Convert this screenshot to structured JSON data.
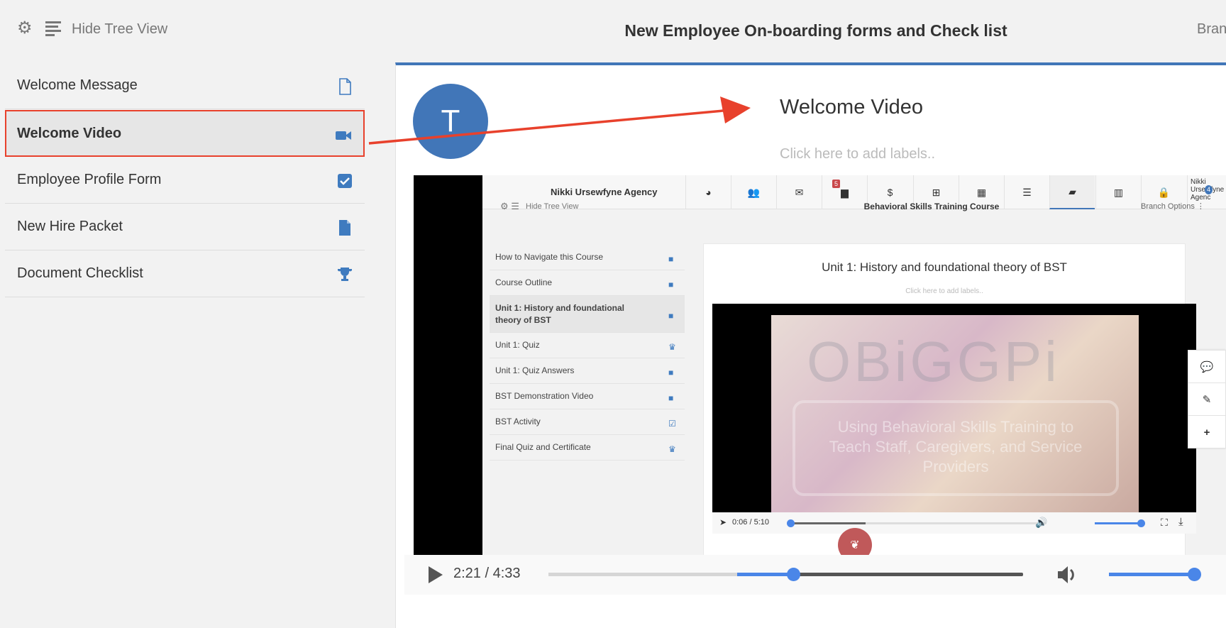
{
  "header": {
    "hide_tree_label": "Hide Tree View",
    "title": "New Employee On-boarding forms and Check list",
    "branch_label": "Bran"
  },
  "sidebar": {
    "items": [
      {
        "label": "Welcome Message",
        "icon": "file-outline-icon"
      },
      {
        "label": "Welcome Video",
        "icon": "video-camera-icon",
        "active": true
      },
      {
        "label": "Employee Profile Form",
        "icon": "checkbox-icon"
      },
      {
        "label": "New Hire Packet",
        "icon": "file-icon"
      },
      {
        "label": "Document Checklist",
        "icon": "trophy-icon"
      }
    ]
  },
  "main": {
    "avatar_letter": "T",
    "title": "Welcome Video",
    "labels_placeholder": "Click here to add labels.."
  },
  "embedded": {
    "brand": "Nikki Ursewfyne Agency",
    "nav_icons": [
      "dashboard-icon",
      "users-icon",
      "envelope-icon",
      "briefcase-icon",
      "dollar-icon",
      "plus-square-icon",
      "calendar-icon",
      "list-icon",
      "book-icon",
      "bar-chart-icon",
      "lock-icon"
    ],
    "nav_badge": "5",
    "profile_alt": "Nikki Ursewfyne Agenc",
    "profile_badge": "4",
    "hide_tree_label": "Hide Tree View",
    "course_title": "Behavioral Skills Training Course",
    "branch_options": "Branch Options",
    "tree": [
      {
        "label": "How to Navigate this Course",
        "icon": "video-camera-icon"
      },
      {
        "label": "Course Outline",
        "icon": "file-icon"
      },
      {
        "label": "Unit 1: History and foundational theory of BST",
        "icon": "video-camera-icon",
        "active": true
      },
      {
        "label": "Unit 1: Quiz",
        "icon": "trophy-icon"
      },
      {
        "label": "Unit 1: Quiz Answers",
        "icon": "file-icon"
      },
      {
        "label": "BST Demonstration Video",
        "icon": "video-camera-icon"
      },
      {
        "label": "BST Activity",
        "icon": "checkbox-icon"
      },
      {
        "label": "Final Quiz and Certificate",
        "icon": "trophy-icon"
      }
    ],
    "unit_title": "Unit 1: History and foundational theory of BST",
    "labels_placeholder": "Click here to add labels..",
    "video_logo": "OBiGGPi",
    "video_caption": "Using Behavioral Skills Training to Teach Staff, Caregivers, and Service Providers",
    "player_time": "0:06 / 5:10",
    "player_progress_percent": 2,
    "player_volume_percent": 100
  },
  "player": {
    "time": "2:21 / 4:33",
    "progress_percent": 51.6,
    "volume_percent": 100
  },
  "colors": {
    "accent": "#4176b8",
    "highlight_border": "#e8412c",
    "slider": "#4a86e8"
  }
}
